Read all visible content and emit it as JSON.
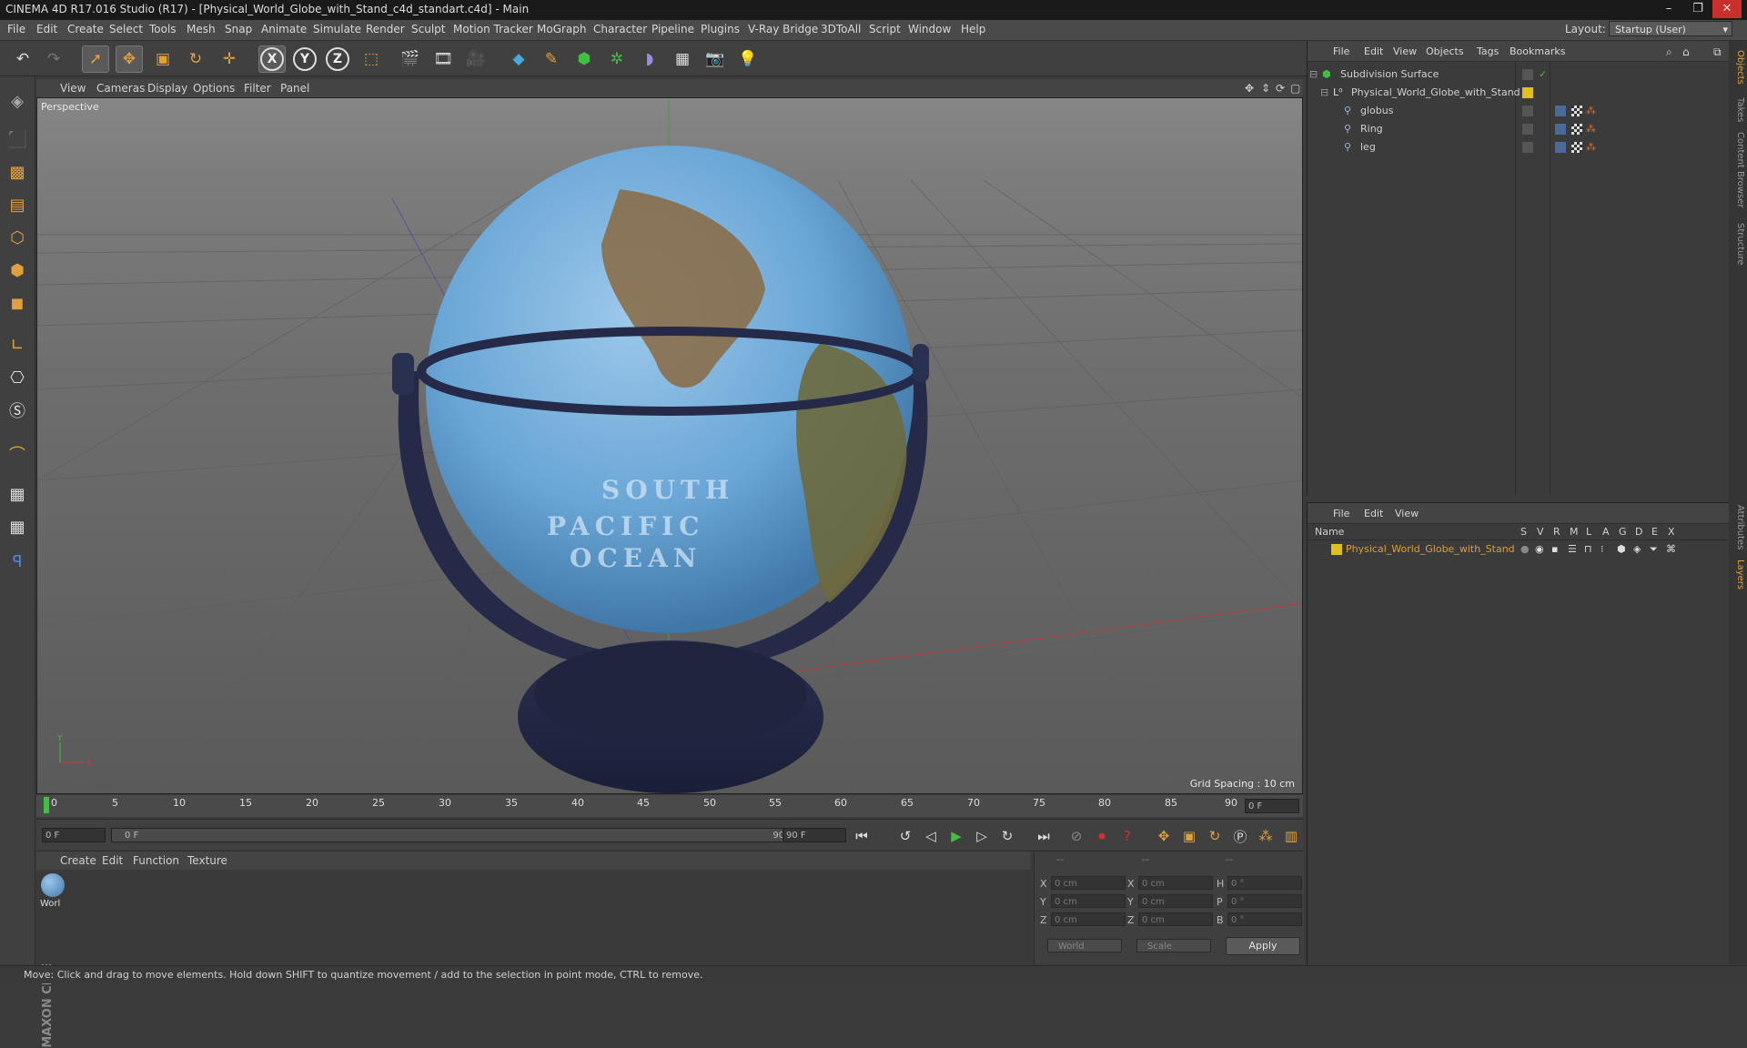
{
  "window": {
    "title": "CINEMA 4D R17.016 Studio (R17) - [Physical_World_Globe_with_Stand_c4d_standart.c4d] - Main"
  },
  "menu": {
    "items": [
      "File",
      "Edit",
      "Create",
      "Select",
      "Tools",
      "Mesh",
      "Snap",
      "Animate",
      "Simulate",
      "Render",
      "Sculpt",
      "Motion Tracker",
      "MoGraph",
      "Character",
      "Pipeline",
      "Plugins",
      "V-Ray Bridge",
      "3DToAll",
      "Script",
      "Window",
      "Help"
    ],
    "layout_label": "Layout:",
    "layout_value": "Startup (User)"
  },
  "toolbar": {
    "axis_x": "X",
    "axis_y": "Y",
    "axis_z": "Z"
  },
  "viewport": {
    "menu": [
      "View",
      "Cameras",
      "Display",
      "Options",
      "Filter",
      "Panel"
    ],
    "camera_label": "Perspective",
    "grid_spacing": "Grid Spacing : 10 cm",
    "globe_text": [
      "SOUTH",
      "PACIFIC",
      "OCEAN"
    ],
    "axis_y": "Y",
    "axis_x": "X"
  },
  "timeline": {
    "ticks": [
      "0",
      "5",
      "10",
      "15",
      "20",
      "25",
      "30",
      "35",
      "40",
      "45",
      "50",
      "55",
      "60",
      "65",
      "70",
      "75",
      "80",
      "85",
      "90"
    ],
    "current_frame": "0 F",
    "start_field": "0 F",
    "range_start": "0 F",
    "range_end": "90 F",
    "end_field": "90 F"
  },
  "material_panel": {
    "menu": [
      "Create",
      "Edit",
      "Function",
      "Texture"
    ],
    "materials": [
      {
        "name": "Worl"
      }
    ]
  },
  "coordinates": {
    "header": [
      "--",
      "--",
      "--"
    ],
    "rows": [
      {
        "l1": "X",
        "v1": "0 cm",
        "l2": "X",
        "v2": "0 cm",
        "l3": "H",
        "v3": "0 °"
      },
      {
        "l1": "Y",
        "v1": "0 cm",
        "l2": "Y",
        "v2": "0 cm",
        "l3": "P",
        "v3": "0 °"
      },
      {
        "l1": "Z",
        "v1": "0 cm",
        "l2": "Z",
        "v2": "0 cm",
        "l3": "B",
        "v3": "0 °"
      }
    ],
    "mode_world": "World",
    "mode_scale": "Scale",
    "apply": "Apply"
  },
  "object_manager": {
    "menu": [
      "File",
      "Edit",
      "View",
      "Objects",
      "Tags",
      "Bookmarks"
    ],
    "objects": [
      {
        "name": "Subdivision Surface",
        "indent": 0
      },
      {
        "name": "Physical_World_Globe_with_Stand",
        "indent": 1
      },
      {
        "name": "globus",
        "indent": 2
      },
      {
        "name": "Ring",
        "indent": 2
      },
      {
        "name": "leg",
        "indent": 2
      }
    ]
  },
  "layer_manager": {
    "menu": [
      "File",
      "Edit",
      "View"
    ],
    "columns": [
      "Name",
      "S",
      "V",
      "R",
      "M",
      "L",
      "A",
      "G",
      "D",
      "E",
      "X"
    ],
    "layers": [
      {
        "name": "Physical_World_Globe_with_Stand",
        "color": "#e0c020"
      }
    ]
  },
  "right_tabs": [
    "Objects",
    "Takes",
    "Content Browser",
    "Structure",
    "Attributes",
    "Layers"
  ],
  "status": "Move: Click and drag to move elements. Hold down SHIFT to quantize movement / add to the selection in point mode, CTRL to remove."
}
